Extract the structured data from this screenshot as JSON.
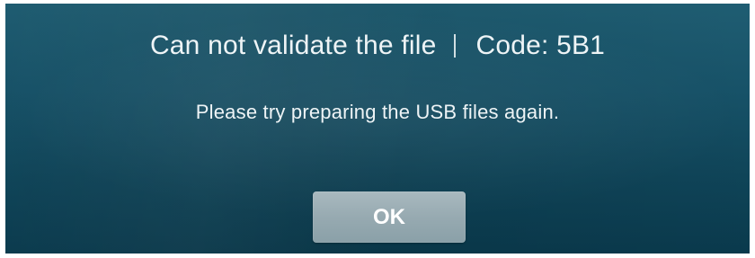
{
  "dialog": {
    "title": "Can not validate the file",
    "title_separator": "|",
    "code_text": "Code: 5B1",
    "message": "Please try preparing the USB files again.",
    "ok_label": "OK"
  },
  "colors": {
    "background_top": "#1f5d72",
    "background_bottom": "#0a3a4d",
    "text": "#eef4f6",
    "button": "#97aab1"
  }
}
